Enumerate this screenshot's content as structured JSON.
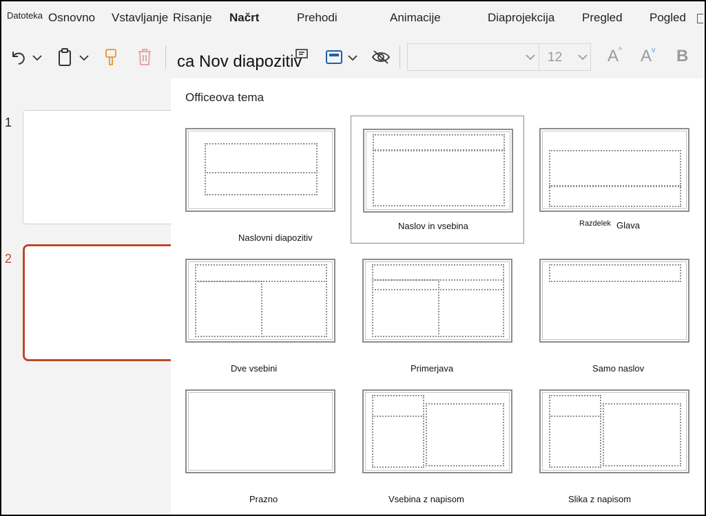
{
  "ribbon": {
    "tabs": [
      "Datoteka",
      "Osnovno",
      "Vstavljanje",
      "Risanje",
      "Načrt",
      "Prehodi",
      "Animacije",
      "Diaprojekcija",
      "Pregled",
      "Pogled"
    ]
  },
  "toolbar": {
    "new_slide_label": "ca Nov diapozitiv",
    "font_size": "12",
    "bold_label": "B",
    "grow_font_label": "A",
    "shrink_font_label": "A"
  },
  "thumbnails": {
    "slides": [
      {
        "number": "1",
        "selected": false
      },
      {
        "number": "2",
        "selected": true
      }
    ],
    "accent_color": "#c0462b"
  },
  "layout_menu": {
    "heading": "Officeova tema",
    "layouts": [
      {
        "label": "Naslovni diapozitiv",
        "selected": false
      },
      {
        "label": "Naslov in vsebina",
        "selected": true
      },
      {
        "label_small": "Razdelek",
        "label": "Glava",
        "selected": false
      },
      {
        "label": "Dve vsebini",
        "selected": false
      },
      {
        "label": "Primerjava",
        "selected": false
      },
      {
        "label": "Samo naslov",
        "selected": false
      },
      {
        "label": "Prazno",
        "selected": false
      },
      {
        "label": "Vsebina z napisom",
        "selected": false
      },
      {
        "label": "Slika z napisom",
        "selected": false
      }
    ]
  },
  "icons": [
    "undo-icon",
    "chevron-down-icon",
    "clipboard-icon",
    "format-painter-icon",
    "delete-icon",
    "layout-icon",
    "slide-design-icon",
    "hide-slide-icon"
  ]
}
